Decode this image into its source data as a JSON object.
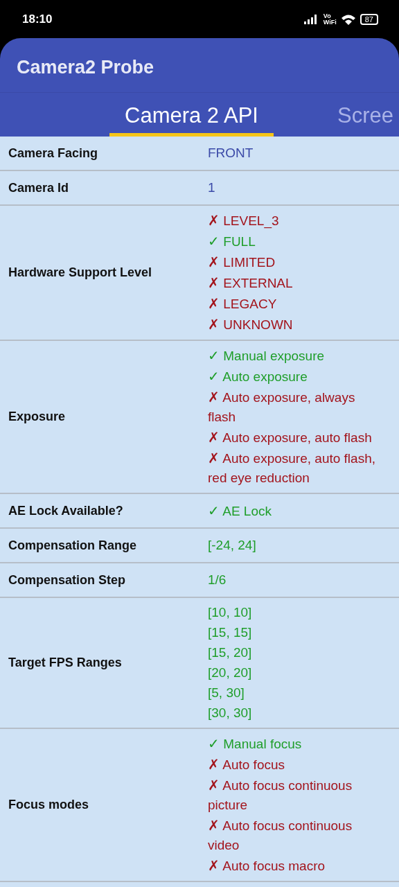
{
  "status_bar": {
    "time": "18:10",
    "network": "Vo\nWiFi",
    "battery": "87"
  },
  "app_bar": {
    "title": "Camera2 Probe"
  },
  "tabs": [
    {
      "label": "Camera 2 API",
      "selected": true
    },
    {
      "label": "Scree",
      "selected": false
    }
  ],
  "rows": [
    {
      "label": "Camera Facing",
      "values": [
        {
          "kind": "plain",
          "text": "FRONT"
        }
      ]
    },
    {
      "label": "Camera Id",
      "values": [
        {
          "kind": "plain",
          "text": "1"
        }
      ]
    },
    {
      "label": "Hardware Support Level",
      "values": [
        {
          "kind": "no",
          "mark": "✗",
          "text": "LEVEL_3"
        },
        {
          "kind": "yes",
          "mark": "✓",
          "text": "FULL"
        },
        {
          "kind": "no",
          "mark": "✗",
          "text": "LIMITED"
        },
        {
          "kind": "no",
          "mark": "✗",
          "text": "EXTERNAL"
        },
        {
          "kind": "no",
          "mark": "✗",
          "text": "LEGACY"
        },
        {
          "kind": "no",
          "mark": "✗",
          "text": "UNKNOWN"
        }
      ]
    },
    {
      "label": "Exposure",
      "values": [
        {
          "kind": "yes",
          "mark": "✓",
          "text": "Manual exposure"
        },
        {
          "kind": "yes",
          "mark": "✓",
          "text": "Auto exposure"
        },
        {
          "kind": "no",
          "mark": "✗",
          "text": "Auto exposure, always flash"
        },
        {
          "kind": "no",
          "mark": "✗",
          "text": "Auto exposure, auto flash"
        },
        {
          "kind": "no",
          "mark": "✗",
          "text": "Auto exposure, auto flash, red eye reduction"
        }
      ]
    },
    {
      "label": "AE Lock Available?",
      "values": [
        {
          "kind": "yes",
          "mark": "✓",
          "text": "AE Lock"
        }
      ]
    },
    {
      "label": "Compensation Range",
      "values": [
        {
          "kind": "info",
          "text": "[-24, 24]"
        }
      ]
    },
    {
      "label": "Compensation Step",
      "values": [
        {
          "kind": "info",
          "text": "1/6"
        }
      ]
    },
    {
      "label": "Target FPS Ranges",
      "values": [
        {
          "kind": "info",
          "text": "[10, 10]"
        },
        {
          "kind": "info",
          "text": "[15, 15]"
        },
        {
          "kind": "info",
          "text": "[15, 20]"
        },
        {
          "kind": "info",
          "text": "[20, 20]"
        },
        {
          "kind": "info",
          "text": "[5, 30]"
        },
        {
          "kind": "info",
          "text": "[30, 30]"
        }
      ]
    },
    {
      "label": "Focus modes",
      "values": [
        {
          "kind": "yes",
          "mark": "✓",
          "text": "Manual focus"
        },
        {
          "kind": "no",
          "mark": "✗",
          "text": "Auto focus"
        },
        {
          "kind": "no",
          "mark": "✗",
          "text": "Auto focus continuous picture"
        },
        {
          "kind": "no",
          "mark": "✗",
          "text": "Auto focus continuous video"
        },
        {
          "kind": "no",
          "mark": "✗",
          "text": "Auto focus macro"
        }
      ]
    }
  ]
}
